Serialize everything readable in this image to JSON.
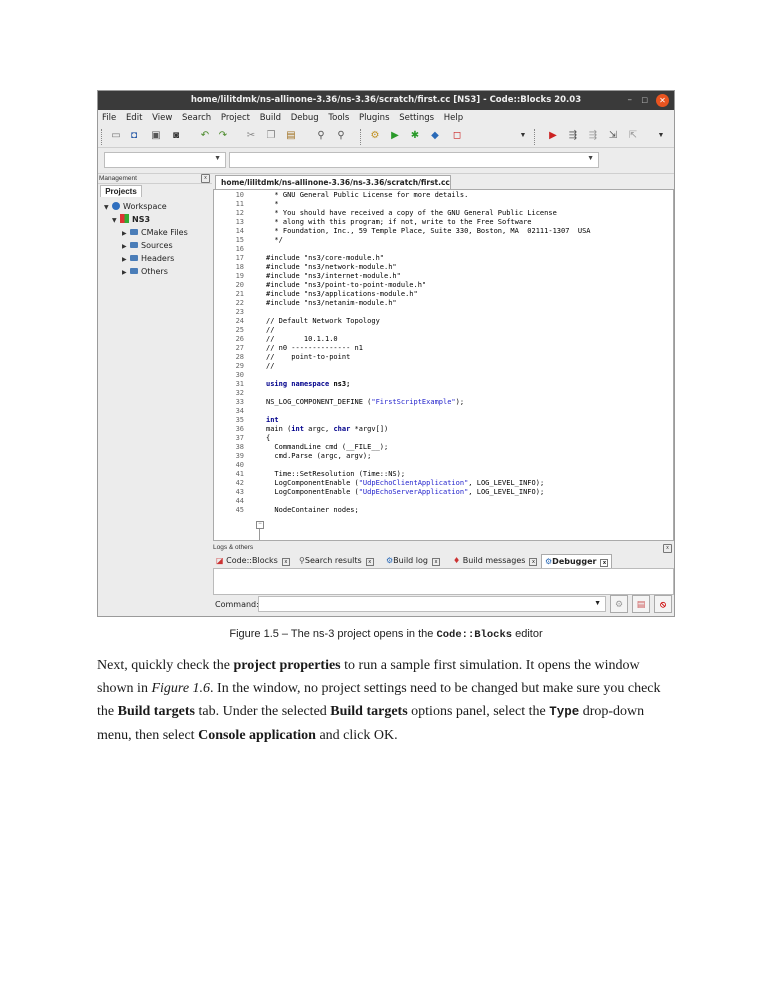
{
  "window": {
    "title": "home/lilitdmk/ns-allinone-3.36/ns-3.36/scratch/first.cc [NS3] - Code::Blocks 20.03",
    "min_glyph": "–",
    "max_glyph": "□",
    "close_glyph": "✕"
  },
  "menu": [
    "File",
    "Edit",
    "View",
    "Search",
    "Project",
    "Build",
    "Debug",
    "Tools",
    "Plugins",
    "Settings",
    "Help"
  ],
  "management": {
    "header": "Management",
    "tab": "Projects",
    "tree": [
      {
        "label": "Workspace"
      },
      {
        "label": "NS3"
      },
      {
        "label": "CMake Files"
      },
      {
        "label": "Sources"
      },
      {
        "label": "Headers"
      },
      {
        "label": "Others"
      }
    ]
  },
  "editor": {
    "tab_label": "home/lilitdmk/ns-allinone-3.36/ns-3.36/scratch/first.cc",
    "lines": [
      {
        "n": "10",
        "t": "  * GNU General Public License for more details.",
        "c": "com"
      },
      {
        "n": "11",
        "t": "  *",
        "c": "com"
      },
      {
        "n": "12",
        "t": "  * You should have received a copy of the GNU General Public License",
        "c": "com"
      },
      {
        "n": "13",
        "t": "  * along with this program; if not, write to the Free Software",
        "c": "com"
      },
      {
        "n": "14",
        "t": "  * Foundation, Inc., 59 Temple Place, Suite 330, Boston, MA  02111-1307  USA",
        "c": "com"
      },
      {
        "n": "15",
        "t": "  */",
        "c": "com"
      },
      {
        "n": "16",
        "t": "",
        "c": ""
      },
      {
        "n": "17",
        "t": "#include \"ns3/core-module.h\"",
        "c": "pp"
      },
      {
        "n": "18",
        "t": "#include \"ns3/network-module.h\"",
        "c": "pp"
      },
      {
        "n": "19",
        "t": "#include \"ns3/internet-module.h\"",
        "c": "pp"
      },
      {
        "n": "20",
        "t": "#include \"ns3/point-to-point-module.h\"",
        "c": "pp"
      },
      {
        "n": "21",
        "t": "#include \"ns3/applications-module.h\"",
        "c": "pp"
      },
      {
        "n": "22",
        "t": "#include \"ns3/netanim-module.h\"",
        "c": "pp"
      },
      {
        "n": "23",
        "t": "",
        "c": ""
      },
      {
        "n": "24",
        "t": "// Default Network Topology",
        "c": "com"
      },
      {
        "n": "25",
        "t": "//",
        "c": "com"
      },
      {
        "n": "26",
        "t": "//       10.1.1.0",
        "c": "com"
      },
      {
        "n": "27",
        "t": "// n0 -------------- n1",
        "c": "com"
      },
      {
        "n": "28",
        "t": "//    point-to-point",
        "c": "com"
      },
      {
        "n": "29",
        "t": "//",
        "c": "com"
      },
      {
        "n": "30",
        "t": "",
        "c": ""
      },
      {
        "n": "31",
        "t": "using namespace ns3;",
        "c": "kw"
      },
      {
        "n": "32",
        "t": "",
        "c": ""
      },
      {
        "n": "33",
        "t": "NS_LOG_COMPONENT_DEFINE (\"FirstScriptExample\");",
        "c": ""
      },
      {
        "n": "34",
        "t": "",
        "c": ""
      },
      {
        "n": "35",
        "t": "int",
        "c": "kw"
      },
      {
        "n": "36",
        "t": "main (int argc, char *argv[])",
        "c": ""
      },
      {
        "n": "37",
        "t": "{",
        "c": ""
      },
      {
        "n": "38",
        "t": "  CommandLine cmd (__FILE__);",
        "c": ""
      },
      {
        "n": "39",
        "t": "  cmd.Parse (argc, argv);",
        "c": ""
      },
      {
        "n": "40",
        "t": "",
        "c": ""
      },
      {
        "n": "41",
        "t": "  Time::SetResolution (Time::NS);",
        "c": ""
      },
      {
        "n": "42",
        "t": "  LogComponentEnable (\"UdpEchoClientApplication\", LOG_LEVEL_INFO);",
        "c": ""
      },
      {
        "n": "43",
        "t": "  LogComponentEnable (\"UdpEchoServerApplication\", LOG_LEVEL_INFO);",
        "c": ""
      },
      {
        "n": "44",
        "t": "",
        "c": ""
      },
      {
        "n": "45",
        "t": "  NodeContainer nodes;",
        "c": ""
      }
    ]
  },
  "logs": {
    "header": "Logs & others",
    "tabs": [
      "Code::Blocks",
      "Search results",
      "Build log",
      "Build messages",
      "Debugger"
    ],
    "active_tab": "Debugger",
    "command_label": "Command:"
  },
  "document": {
    "caption_prefix": "Figure 1.5 – The ns-3 project opens in the ",
    "caption_code": "Code::Blocks",
    "caption_suffix": " editor",
    "p1_a": "Next, quickly check the ",
    "p1_b": "project properties",
    "p1_c": " to run a sample first simulation. It opens the window",
    "p2_a": "shown in ",
    "p2_b": "Figure 1.6",
    "p2_c": ". In the window, no project settings need to be changed but make sure you check",
    "p3_a": "the ",
    "p3_b": "Build targets",
    "p3_c": " tab. Under the selected ",
    "p3_d": "Build targets",
    "p3_e": " options panel, select the ",
    "p3_f": "Type",
    "p3_g": " drop-down",
    "p4_a": "menu, then select ",
    "p4_b": "Console application",
    "p4_c": " and click OK."
  }
}
